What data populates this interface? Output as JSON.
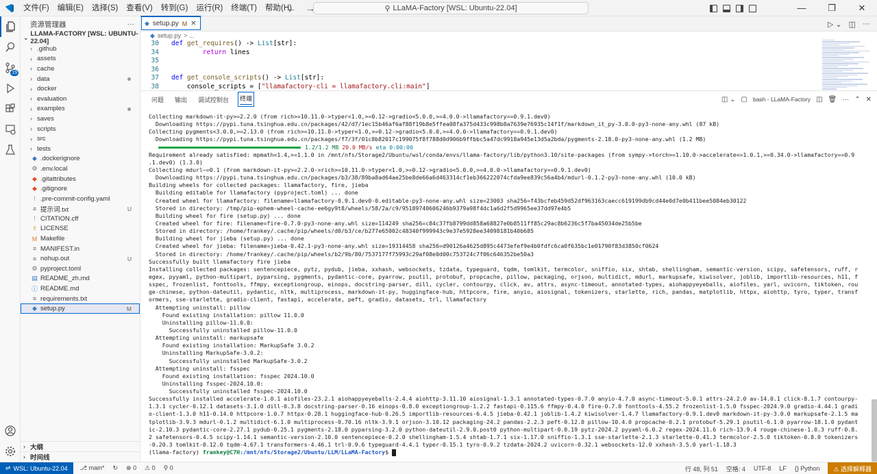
{
  "menu": [
    "文件(F)",
    "编辑(E)",
    "选择(S)",
    "查看(V)",
    "转到(G)",
    "运行(R)",
    "终端(T)",
    "帮助(H)"
  ],
  "search": {
    "text": "LLaMA-Factory [WSL: Ubuntu-22.04]"
  },
  "activity": {
    "badge": "19"
  },
  "sidebar": {
    "title": "资源管理器",
    "root": "LLAMA-FACTORY [WSL: UBUNTU-22.04]",
    "items": [
      {
        "label": ".github",
        "folder": true,
        "dot": false,
        "status": ""
      },
      {
        "label": "assets",
        "folder": true,
        "dot": false,
        "status": ""
      },
      {
        "label": "cache",
        "folder": true,
        "dot": false,
        "status": ""
      },
      {
        "label": "data",
        "folder": true,
        "dot": true,
        "status": ""
      },
      {
        "label": "docker",
        "folder": true,
        "dot": false,
        "status": ""
      },
      {
        "label": "evaluation",
        "folder": true,
        "dot": false,
        "status": ""
      },
      {
        "label": "examples",
        "folder": true,
        "dot": true,
        "status": ""
      },
      {
        "label": "saves",
        "folder": true,
        "dot": false,
        "status": ""
      },
      {
        "label": "scripts",
        "folder": true,
        "dot": false,
        "status": ""
      },
      {
        "label": "src",
        "folder": true,
        "dot": false,
        "status": ""
      },
      {
        "label": "tests",
        "folder": true,
        "dot": false,
        "status": ""
      },
      {
        "label": ".dockerignore",
        "icon": "◆",
        "color": "#3b7bbf",
        "status": ""
      },
      {
        "label": ".env.local",
        "icon": "⚙",
        "color": "#6a6a6a",
        "status": ""
      },
      {
        "label": ".gitattributes",
        "icon": "◆",
        "color": "#e44c2c",
        "status": ""
      },
      {
        "label": ".gitignore",
        "icon": "◆",
        "color": "#e44c2c",
        "status": ""
      },
      {
        "label": ".pre-commit-config.yaml",
        "icon": "!",
        "color": "#a074c4",
        "status": ""
      },
      {
        "label": "提示词.txt",
        "icon": "≡",
        "color": "#6a6a6a",
        "status": "U"
      },
      {
        "label": "CITATION.cff",
        "icon": "!",
        "color": "#a074c4",
        "status": ""
      },
      {
        "label": "LICENSE",
        "icon": "♗",
        "color": "#cba13b",
        "status": ""
      },
      {
        "label": "Makefile",
        "icon": "M",
        "color": "#e37933",
        "status": ""
      },
      {
        "label": "MANIFEST.in",
        "icon": "≡",
        "color": "#6a6a6a",
        "status": ""
      },
      {
        "label": "nohup.out",
        "icon": "≡",
        "color": "#6a6a6a",
        "status": "U"
      },
      {
        "label": "pyproject.toml",
        "icon": "⚙",
        "color": "#6a6a6a",
        "status": ""
      },
      {
        "label": "README_zh.md",
        "icon": "▤",
        "color": "#3b7bbf",
        "status": ""
      },
      {
        "label": "README.md",
        "icon": "ⓘ",
        "color": "#3b7bbf",
        "status": ""
      },
      {
        "label": "requirements.txt",
        "icon": "≡",
        "color": "#6a6a6a",
        "status": ""
      },
      {
        "label": "setup.py",
        "icon": "◆",
        "color": "#3b7bbf",
        "status": "M",
        "selected": true
      }
    ],
    "outline": "大纲",
    "timeline": "时间线"
  },
  "editor": {
    "tab_label": "setup.py",
    "tab_mod": "M",
    "breadcrumb_file": "setup.py",
    "breadcrumb_rest": "> ...",
    "lines": [
      {
        "n": "30",
        "segs": [
          [
            "kw",
            "def "
          ],
          [
            "fn",
            "get_requires"
          ],
          [
            "",
            "() -> "
          ],
          [
            "ty",
            "List"
          ],
          [
            "",
            "[str]:"
          ]
        ]
      },
      {
        "n": "34",
        "segs": [
          [
            "",
            "        "
          ],
          [
            "cf",
            "return"
          ],
          [
            "",
            " lines"
          ]
        ]
      },
      {
        "n": "35",
        "segs": [
          [
            "",
            ""
          ]
        ]
      },
      {
        "n": "36",
        "segs": [
          [
            "",
            ""
          ]
        ]
      },
      {
        "n": "37",
        "segs": [
          [
            "kw",
            "def "
          ],
          [
            "fn",
            "get_console_scripts"
          ],
          [
            "",
            "() -> "
          ],
          [
            "ty",
            "List"
          ],
          [
            "",
            "[str]:"
          ]
        ]
      },
      {
        "n": "38",
        "segs": [
          [
            "",
            "    console_scripts = ["
          ],
          [
            "st",
            "\"llamafactory-cli = llamafactory.cli:main\""
          ],
          [
            "",
            "]"
          ]
        ]
      }
    ]
  },
  "panel": {
    "tabs": [
      "问题",
      "输出",
      "调试控制台",
      "终端"
    ],
    "terminal_name": "bash - LLaMA-Factory",
    "lines": [
      "Collecting markdown-it-py>=2.2.0 (from rich>=10.11.0->typer<1.0,>=0.12->gradio<5.0.0,>=4.0.0->llamafactory==0.9.1.dev0)",
      "  Downloading https://pypi.tuna.tsinghua.edu.cn/packages/42/d7/1ec15b46af6af88f19b8e5ffea08fa375d433c998b8a7639e76935c14f1f/markdown_it_py-3.0.0-py3-none-any.whl (87 kB)",
      "Collecting pygments<3.0.0,>=2.13.0 (from rich>=10.11.0->typer<1.0,>=0.12->gradio<5.0.0,>=4.0.0->llamafactory==0.9.1.dev0)",
      "  Downloading https://pypi.tuna.tsinghua.edu.cn/packages/f7/3f/01c8b82017c199075f8f788d0d906b9ffbbc5a47dc9918a945e13d5a2bda/pygments-2.18.0-py3-none-any.whl (1.2 MB)",
      "__PROGRESS__",
      "Requirement already satisfied: mpmath<1.4,>=1.1.0 in /mnt/nfs/Storage2/Ubuntu/wsl/conda/envs/llama-factory/lib/python3.10/site-packages (from sympy->torch>=1.10.0->accelerate<=1.0.1,>=0.34.0->llamafactory==0.9",
      ".1.dev0) (1.3.0)",
      "Collecting mdurl~=0.1 (from markdown-it-py>=2.2.0->rich>=10.11.0->typer<1.0,>=0.12->gradio<5.0.0,>=4.0.0->llamafactory==0.9.1.dev0)",
      "  Downloading https://pypi.tuna.tsinghua.edu.cn/packages/b3/38/89ba8ad64ae25be8de66a6d463314cf1eb366222074cfda9ee839c56a4b4/mdurl-0.1.2-py3-none-any.whl (10.0 kB)",
      "Building wheels for collected packages: llamafactory, fire, jieba",
      "  Building editable for llamafactory (pyproject.toml) ... done",
      "  Created wheel for llamafactory: filename=llamafactory-0.9.1.dev0-0.editable-py3-none-any.whl size=23003 sha256=f43bcfeb459d52df963163caecc619199db9cd44e0d7e0b411bee5084eb30122",
      "  Stored in directory: /tmp/pip-ephem-wheel-cache-ee6gy9t8/wheels/58/2a/c9/95189740606246b9379a98f4dc1a6d2f5d9965ee37dd97e4b5",
      "  Building wheel for fire (setup.py) ... done",
      "  Created wheel for fire: filename=fire-0.7.0-py3-none-any.whl size=114249 sha256=c84c37fb8799dd858a68827e0b8511ff85c29ac8b6236c5f7ba45034de25b5be",
      "  Stored in directory: /home/frankey/.cache/pip/wheels/d0/b3/ce/b277e65002c48340f999943c9e37e5928ee34098181b40b685",
      "  Building wheel for jieba (setup.py) ... done",
      "  Created wheel for jieba: filename=jieba-0.42.1-py3-none-any.whl size=19314458 sha256=d90126a4625d895c4473efef9e4b0fdfc6ca0f635bc1e01790f83d3850cf0624",
      "  Stored in directory: /home/frankey/.cache/pip/wheels/b2/9b/80/7537177f75993c29af08e0d00c753724c7f06c646352be50a3",
      "Successfully built llamafactory fire jieba",
      "Installing collected packages: sentencepiece, pytz, pydub, jieba, xxhash, websockets, tzdata, typeguard, tqdm, tomlkit, termcolor, sniffio, six, shtab, shellingham, semantic-version, scipy, safetensors, ruff, r",
      "egex, pyyaml, python-multipart, pyparsing, pygments, pydantic-core, pyarrow, psutil, protobuf, propcache, pillow, packaging, orjson, multidict, mdurl, markupsafe, kiwisolver, joblib, importlib-resources, h11, f",
      "sspec, frozenlist, fonttools, ffmpy, exceptiongroup, einops, docstring-parser, dill, cycler, contourpy, click, av, attrs, async-timeout, annotated-types, aiohappyeyeballs, aiofiles, yarl, uvicorn, tiktoken, rou",
      "ge-chinese, python-dateutil, pydantic, nltk, multiprocess, markdown-it-py, huggingface-hub, httpcore, fire, anyio, aiosignal, tokenizers, starlette, rich, pandas, matplotlib, httpx, aiohttp, tyro, typer, transf",
      "ormers, sse-starlette, gradio-client, fastapi, accelerate, peft, gradio, datasets, trl, llamafactory",
      "  Attempting uninstall: pillow",
      "    Found existing installation: pillow 11.0.0",
      "    Uninstalling pillow-11.0.0:",
      "      Successfully uninstalled pillow-11.0.0",
      "  Attempting uninstall: markupsafe",
      "    Found existing installation: MarkupSafe 3.0.2",
      "    Uninstalling MarkupSafe-3.0.2:",
      "      Successfully uninstalled MarkupSafe-3.0.2",
      "  Attempting uninstall: fsspec",
      "    Found existing installation: fsspec 2024.10.0",
      "    Uninstalling fsspec-2024.10.0:",
      "      Successfully uninstalled fsspec-2024.10.0",
      "Successfully installed accelerate-1.0.1 aiofiles-23.2.1 aiohappyeyeballs-2.4.4 aiohttp-3.11.10 aiosignal-1.3.1 annotated-types-0.7.0 anyio-4.7.0 async-timeout-5.0.1 attrs-24.2.0 av-14.0.1 click-8.1.7 contourpy-",
      "1.3.1 cycler-0.12.1 datasets-3.1.0 dill-0.3.8 docstring-parser-0.16 einops-0.8.0 exceptiongroup-1.2.2 fastapi-0.115.6 ffmpy-0.4.0 fire-0.7.0 fonttools-4.55.2 frozenlist-1.5.0 fsspec-2024.9.0 gradio-4.44.1 gradi",
      "o-client-1.3.0 h11-0.14.0 httpcore-1.0.7 httpx-0.28.1 huggingface-hub-0.26.5 importlib-resources-6.4.5 jieba-0.42.1 joblib-1.4.2 kiwisolver-1.4.7 llamafactory-0.9.1.dev0 markdown-it-py-3.0.0 markupsafe-2.1.5 ma",
      "tplotlib-3.9.3 mdurl-0.1.2 multidict-6.1.0 multiprocess-0.70.16 nltk-3.9.1 orjson-3.10.12 packaging-24.2 pandas-2.2.3 peft-0.12.0 pillow-10.4.0 propcache-0.2.1 protobuf-5.29.1 psutil-6.1.0 pyarrow-18.1.0 pydant",
      "ic-2.10.3 pydantic-core-2.27.1 pydub-0.25.1 pygments-2.18.0 pyparsing-3.2.0 python-dateutil-2.9.0.post0 python-multipart-0.0.19 pytz-2024.2 pyyaml-6.0.2 regex-2024.11.6 rich-13.9.4 rouge-chinese-1.0.3 ruff-0.8.",
      "2 safetensors-0.4.5 scipy-1.14.1 semantic-version-2.10.0 sentencepiece-0.2.0 shellingham-1.5.4 shtab-1.7.1 six-1.17.0 sniffio-1.3.1 sse-starlette-2.1.3 starlette-0.41.3 termcolor-2.5.0 tiktoken-0.8.0 tokenizers",
      "-0.20.3 tomlkit-0.12.0 tqdm-4.67.1 transformers-4.46.1 trl-0.9.6 typeguard-4.4.1 typer-0.15.1 tyro-0.9.2 tzdata-2024.2 uvicorn-0.32.1 websockets-12.0 xxhash-3.5.0 yarl-1.18.3"
    ],
    "progress": {
      "fraction": 1.0,
      "text": "1.2/1.2 MB",
      "speed": "20.0 MB/s",
      "eta": "eta 0:00:00"
    },
    "prompt": {
      "env": "(llama-factory) ",
      "user": "frankey@C7H",
      "path": ":/mnt/nfs/Storage2/Ubuntu/LLM/LLaMA-Factory",
      "sym": "$ "
    }
  },
  "status": {
    "remote": "WSL: Ubuntu-22.04",
    "branch": "main*",
    "errors": "⊗ 0",
    "warnings": "⚠ 0",
    "ports": "⚲ 0",
    "position": "行 48, 列 51",
    "spaces": "空格: 4",
    "encoding": "UTF-8",
    "eol": "LF",
    "language": "Python",
    "interpreter": "⚠ 选择解释器"
  }
}
